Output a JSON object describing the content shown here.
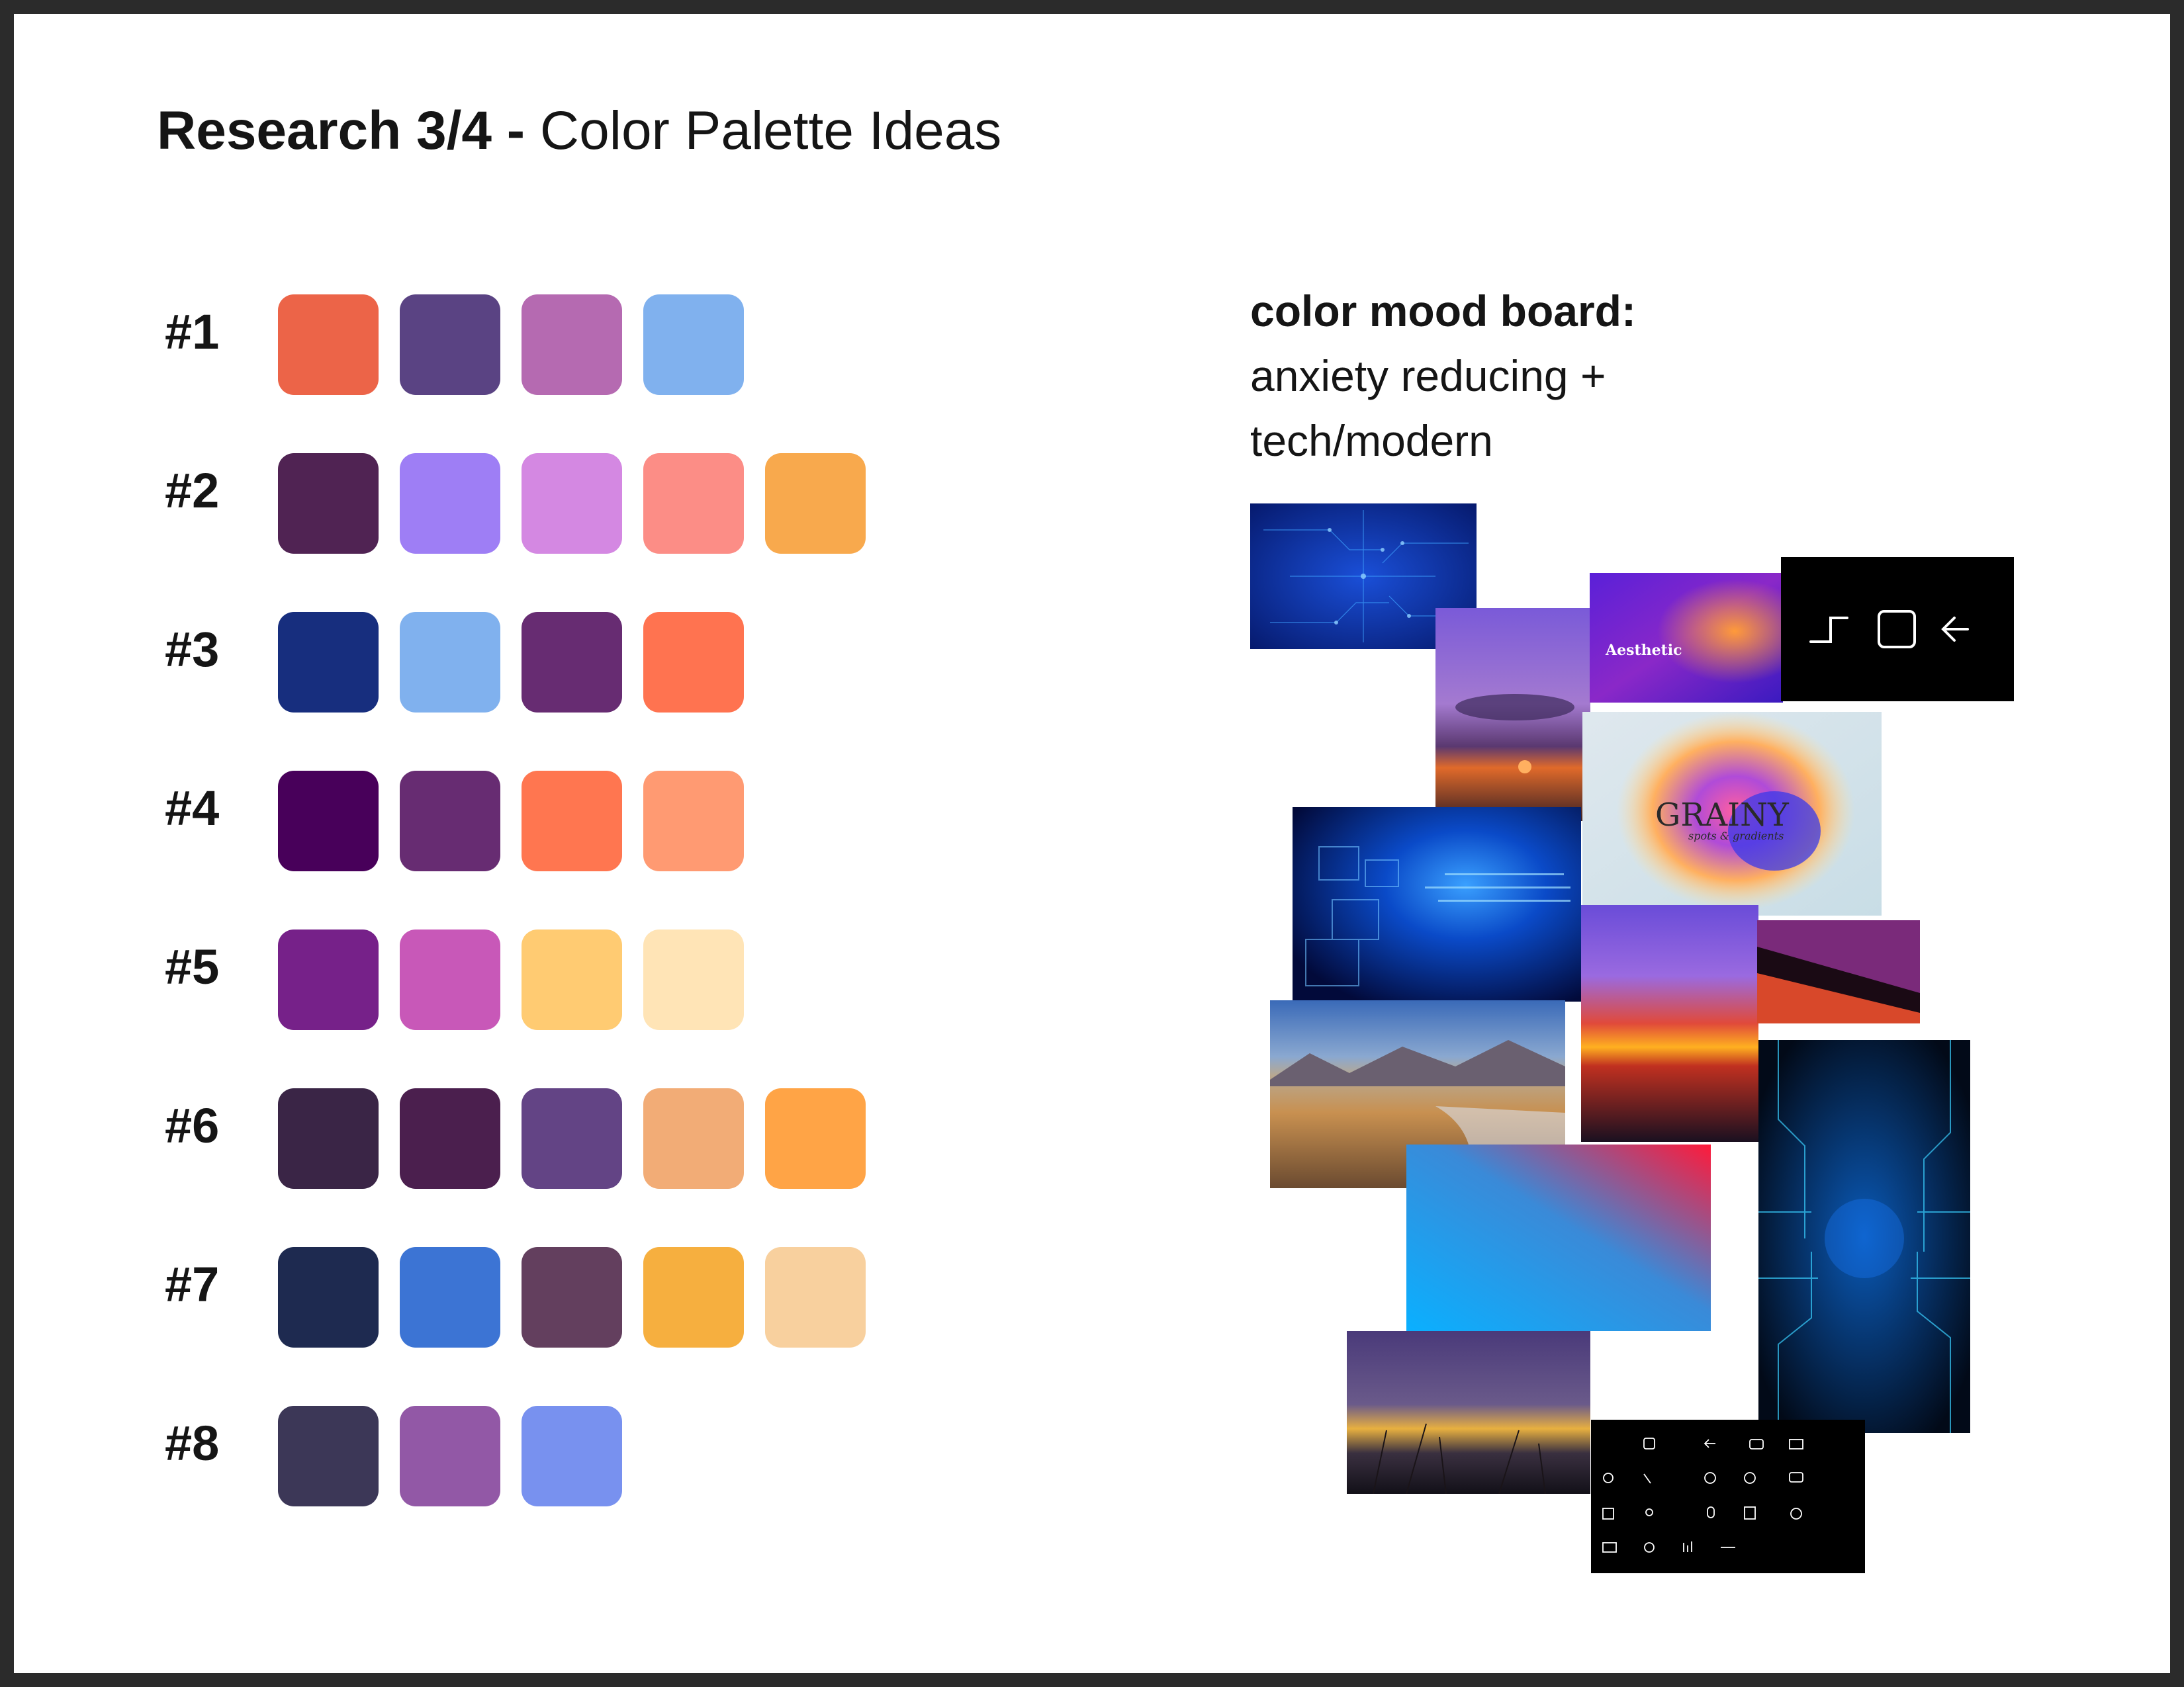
{
  "header": {
    "title_bold": "Research 3/4 -",
    "title_rest": "Color Palette Ideas"
  },
  "palettes": [
    {
      "label": "#1",
      "colors": [
        "#EC6448",
        "#5A4383",
        "#B56AB1",
        "#80B1EE"
      ]
    },
    {
      "label": "#2",
      "colors": [
        "#502353",
        "#9E7EF5",
        "#D488E2",
        "#FC8D86",
        "#F8A94D"
      ]
    },
    {
      "label": "#3",
      "colors": [
        "#172E7E",
        "#80B1EE",
        "#672C72",
        "#FF7350"
      ]
    },
    {
      "label": "#4",
      "colors": [
        "#48005A",
        "#672C72",
        "#FF7650",
        "#FF9A72"
      ]
    },
    {
      "label": "#5",
      "colors": [
        "#762189",
        "#C858B8",
        "#FFCB72",
        "#FFE4B6"
      ]
    },
    {
      "label": "#6",
      "colors": [
        "#3A2546",
        "#4B1F4E",
        "#634485",
        "#F2AC76",
        "#FFA446"
      ]
    },
    {
      "label": "#7",
      "colors": [
        "#1E2A50",
        "#3C74D4",
        "#633F5E",
        "#F6AF3F",
        "#F8D09E"
      ]
    },
    {
      "label": "#8",
      "colors": [
        "#3C3757",
        "#9258A6",
        "#7891EF"
      ]
    }
  ],
  "mood_board": {
    "heading_bold": "color mood board:",
    "heading_line2": "anxiety reducing +",
    "heading_line3": "tech/modern",
    "tiles": {
      "aesthetic_title": "Aesthetic",
      "grainy_title": "GRAINY",
      "grainy_subtitle": "spots & gradients"
    }
  }
}
